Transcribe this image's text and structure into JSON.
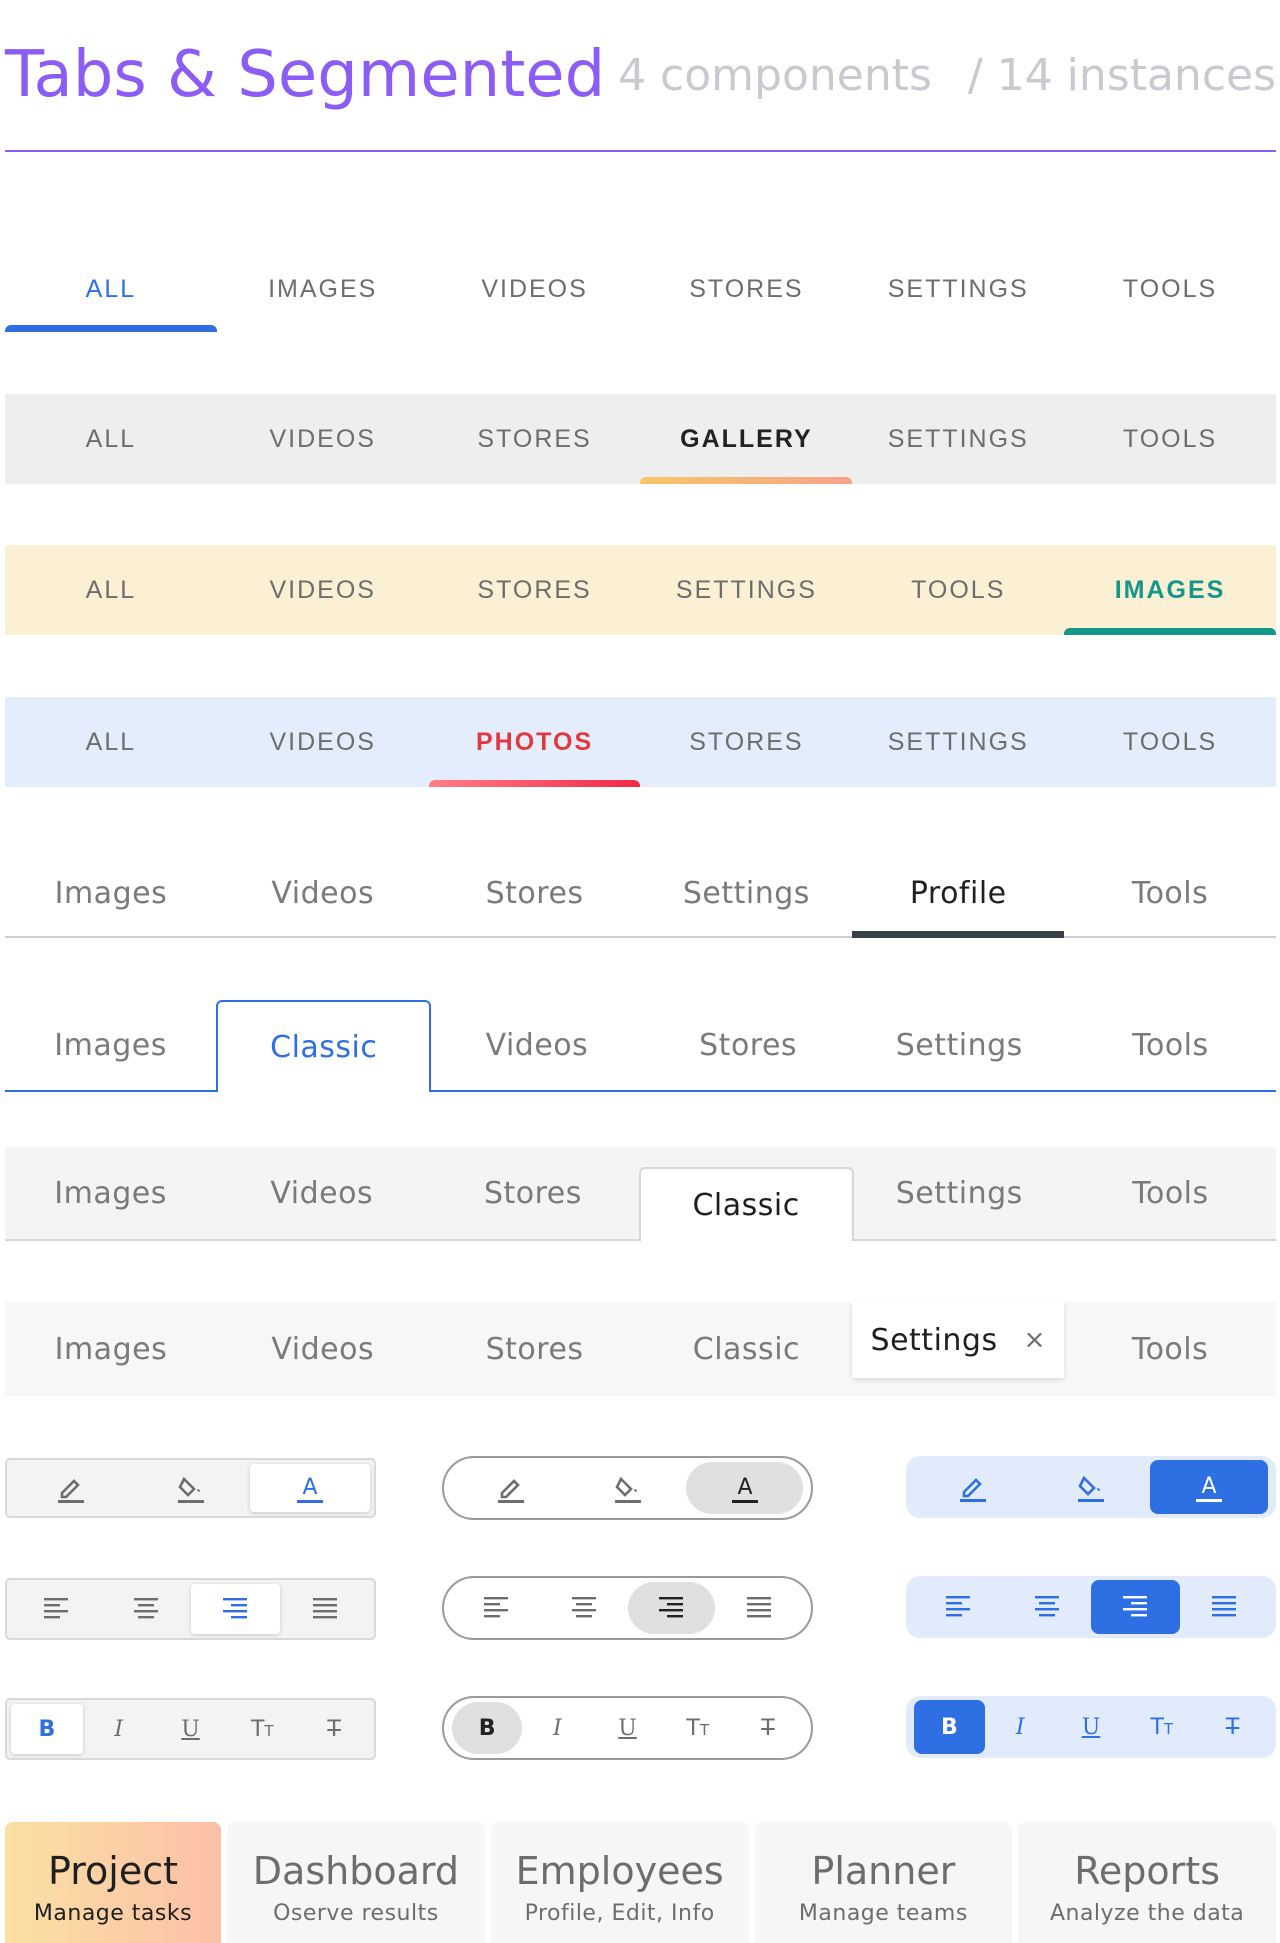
{
  "header": {
    "title": "Tabs & Segmented",
    "components": "4 components",
    "instances": "/ 14 instances"
  },
  "tabs1": [
    "ALL",
    "IMAGES",
    "VIDEOS",
    "STORES",
    "SETTINGS",
    "TOOLS"
  ],
  "tabs2": [
    "ALL",
    "VIDEOS",
    "STORES",
    "GALLERY",
    "SETTINGS",
    "TOOLS"
  ],
  "tabs3": [
    "ALL",
    "VIDEOS",
    "STORES",
    "SETTINGS",
    "TOOLS",
    "IMAGES"
  ],
  "tabs4": [
    "ALL",
    "VIDEOS",
    "PHOTOS",
    "STORES",
    "SETTINGS",
    "TOOLS"
  ],
  "tabs5": [
    "Images",
    "Videos",
    "Stores",
    "Settings",
    "Profile",
    "Tools"
  ],
  "tabs6": [
    "Images",
    "Classic",
    "Videos",
    "Stores",
    "Settings",
    "Tools"
  ],
  "tabs7": [
    "Images",
    "Videos",
    "Stores",
    "Classic",
    "Settings",
    "Tools"
  ],
  "tabs8": [
    "Images",
    "Videos",
    "Stores",
    "Classic",
    "Settings",
    "Tools"
  ],
  "tabs8_close": "×",
  "format": {
    "bold": "B",
    "italic": "I",
    "underline": "U",
    "text_size": "T",
    "text_size_small": "T",
    "strike": "T",
    "font_color_letter": "A"
  },
  "cards": [
    {
      "title": "Project",
      "subtitle": "Manage tasks"
    },
    {
      "title": "Dashboard",
      "subtitle": "Oserve results"
    },
    {
      "title": "Employees",
      "subtitle": "Profile, Edit, Info"
    },
    {
      "title": "Planner",
      "subtitle": "Manage teams"
    },
    {
      "title": "Reports",
      "subtitle": "Analyze the data"
    }
  ],
  "colors": {
    "accent_purple": "#8b5cf6",
    "blue": "#2f6fe4",
    "teal": "#14968a",
    "red": "#e2383f",
    "dark": "#374044"
  }
}
